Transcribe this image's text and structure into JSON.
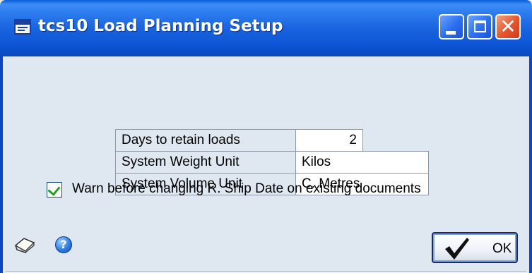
{
  "window": {
    "title": "tcs10 Load Planning Setup",
    "icon": "window-app-icon",
    "controls": [
      "minimize-icon",
      "maximize-icon",
      "close-icon"
    ]
  },
  "form": {
    "days_to_retain": {
      "label": "Days to retain loads",
      "value": "2"
    },
    "weight_unit": {
      "label": "System Weight Unit",
      "value": "Kilos"
    },
    "volume_unit": {
      "label": "System Volume Unit",
      "value": "C. Metres"
    }
  },
  "warn_checkbox": {
    "label": "Warn before changing R. Ship Date on existing documents",
    "checked": true
  },
  "footer": {
    "note_icon": "note-icon",
    "help_icon": "help-icon",
    "ok_label": "OK"
  },
  "colors": {
    "titlebar": "#0a48c2",
    "body": "#dfe7f1",
    "checkmark": "#21a121"
  }
}
